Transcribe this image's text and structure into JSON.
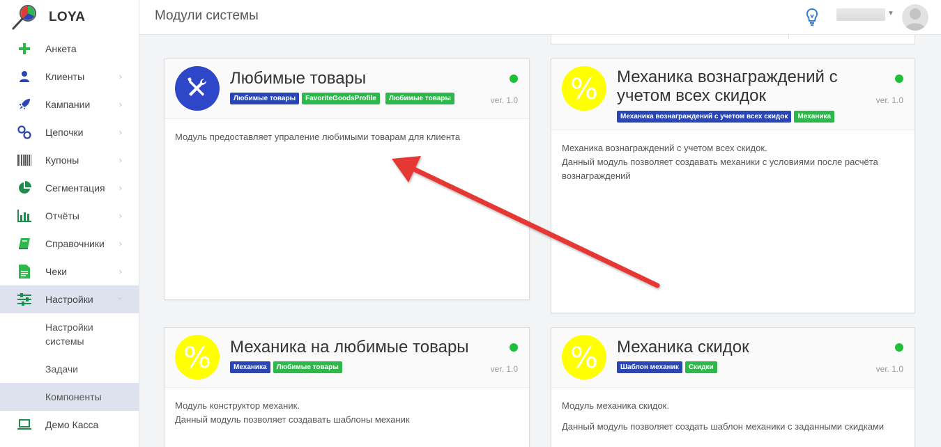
{
  "brand": {
    "name": "LOYA"
  },
  "header": {
    "title": "Модули системы"
  },
  "sidebar": {
    "items": [
      {
        "label": "Анкета",
        "icon": "plus-icon",
        "chevron": false
      },
      {
        "label": "Клиенты",
        "icon": "user-icon",
        "chevron": true
      },
      {
        "label": "Кампании",
        "icon": "rocket-icon",
        "chevron": true
      },
      {
        "label": "Цепочки",
        "icon": "chain-icon",
        "chevron": true
      },
      {
        "label": "Купоны",
        "icon": "barcode-icon",
        "chevron": true
      },
      {
        "label": "Сегментация",
        "icon": "pie-chart-icon",
        "chevron": true
      },
      {
        "label": "Отчёты",
        "icon": "bar-chart-icon",
        "chevron": true
      },
      {
        "label": "Справочники",
        "icon": "book-icon",
        "chevron": true
      },
      {
        "label": "Чеки",
        "icon": "receipt-icon",
        "chevron": true
      },
      {
        "label": "Настройки",
        "icon": "sliders-icon",
        "chevron": true,
        "expanded": true
      }
    ],
    "subitems": [
      {
        "label": "Настройки системы"
      },
      {
        "label": "Задачи"
      },
      {
        "label": "Компоненты",
        "active": true
      }
    ],
    "bottom_item": {
      "label": "Демо Касса",
      "icon": "laptop-icon"
    }
  },
  "cards": [
    {
      "title": "Любимые товары",
      "icon": "wrench-screwdriver-icon",
      "tags": [
        {
          "text": "Любимые товары",
          "color": "blue"
        },
        {
          "text": "FavoriteGoodsProfile",
          "color": "green"
        },
        {
          "text": "Любимые товары",
          "color": "green"
        }
      ],
      "version": "ver. 1.0",
      "lines": [
        "Модуль предоставляет упраление любимыми товарам для клиента"
      ]
    },
    {
      "title": "Механика вознаграждений с учетом всех скидок",
      "icon": "percent-icon",
      "tags": [
        {
          "text": "Механика вознаграждений с учетом всех скидок",
          "color": "blue"
        },
        {
          "text": "Механика",
          "color": "green"
        }
      ],
      "version": "ver. 1.0",
      "lines": [
        "Механика вознаграждений с учетом всех скидок.",
        "Данный модуль позволяет создавать механики с условиями после расчёта вознаграждений"
      ]
    },
    {
      "title": "Механика на любимые товары",
      "icon": "percent-icon",
      "tags": [
        {
          "text": "Механика",
          "color": "blue"
        },
        {
          "text": "Любимые товары",
          "color": "green"
        }
      ],
      "version": "ver. 1.0",
      "lines": [
        "Модуль конструктор механик.",
        "Данный модуль позволяет создавать шаблоны механик"
      ]
    },
    {
      "title": "Механика скидок",
      "icon": "percent-icon",
      "tags": [
        {
          "text": "Шаблон механик",
          "color": "blue"
        },
        {
          "text": "Скидки",
          "color": "green"
        }
      ],
      "version": "ver. 1.0",
      "lines": [
        "Модуль механика скидок.",
        "Данный модуль позволяет создать шаблон механики с заданными скидками"
      ]
    }
  ],
  "percent_symbol": "%",
  "colors": {
    "accent_green": "#2db84b",
    "tag_blue": "#2946b4",
    "status_green": "#1fbf3a",
    "annotation_red": "#e53935",
    "percent_yellow": "#ffff00"
  }
}
